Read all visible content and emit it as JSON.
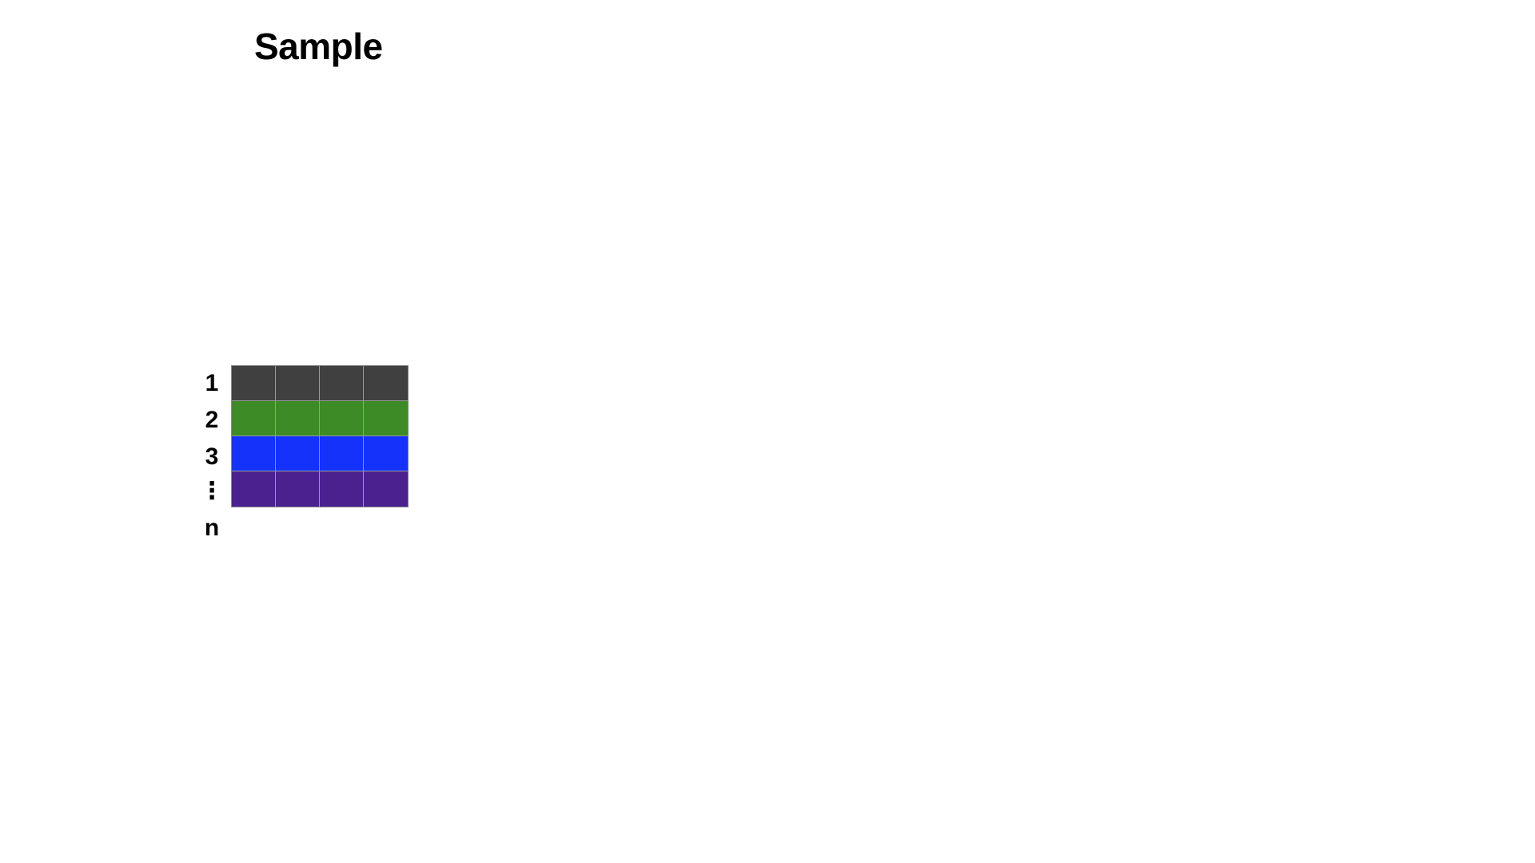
{
  "title": "Sample",
  "row_labels": [
    "1",
    "2",
    "3",
    "⋮",
    "n"
  ],
  "grid": {
    "columns": 4,
    "rows": [
      {
        "color": "#404040"
      },
      {
        "color": "#3d8b27"
      },
      {
        "color": "#1432fa"
      },
      {
        "color": "#4b218f"
      }
    ]
  }
}
